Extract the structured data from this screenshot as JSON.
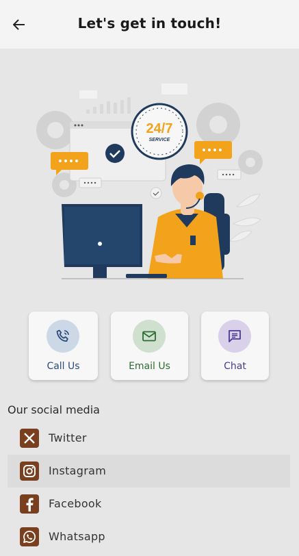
{
  "header": {
    "title": "Let's get in touch!"
  },
  "contact": [
    {
      "label": "Call Us",
      "icon": "phone-icon",
      "color": "#2b4a7a",
      "circle": "#ccd8e6"
    },
    {
      "label": "Email Us",
      "icon": "mail-icon",
      "color": "#2e6b32",
      "circle": "#cfe0cf"
    },
    {
      "label": "Chat",
      "icon": "chat-icon",
      "color": "#4a3a8e",
      "circle": "#d9d1ea"
    }
  ],
  "social": {
    "heading": "Our social media",
    "items": [
      {
        "label": "Twitter",
        "icon": "x-logo-icon"
      },
      {
        "label": "Instagram",
        "icon": "instagram-icon"
      },
      {
        "label": "Facebook",
        "icon": "facebook-icon"
      },
      {
        "label": "Whatsapp",
        "icon": "whatsapp-icon"
      }
    ]
  },
  "illustration": {
    "clock_text": "24/7",
    "clock_sub": "SERVICE"
  },
  "colors": {
    "accent": "#7a3f1e",
    "navy": "#1f3a5c",
    "orange": "#f2a31b"
  }
}
